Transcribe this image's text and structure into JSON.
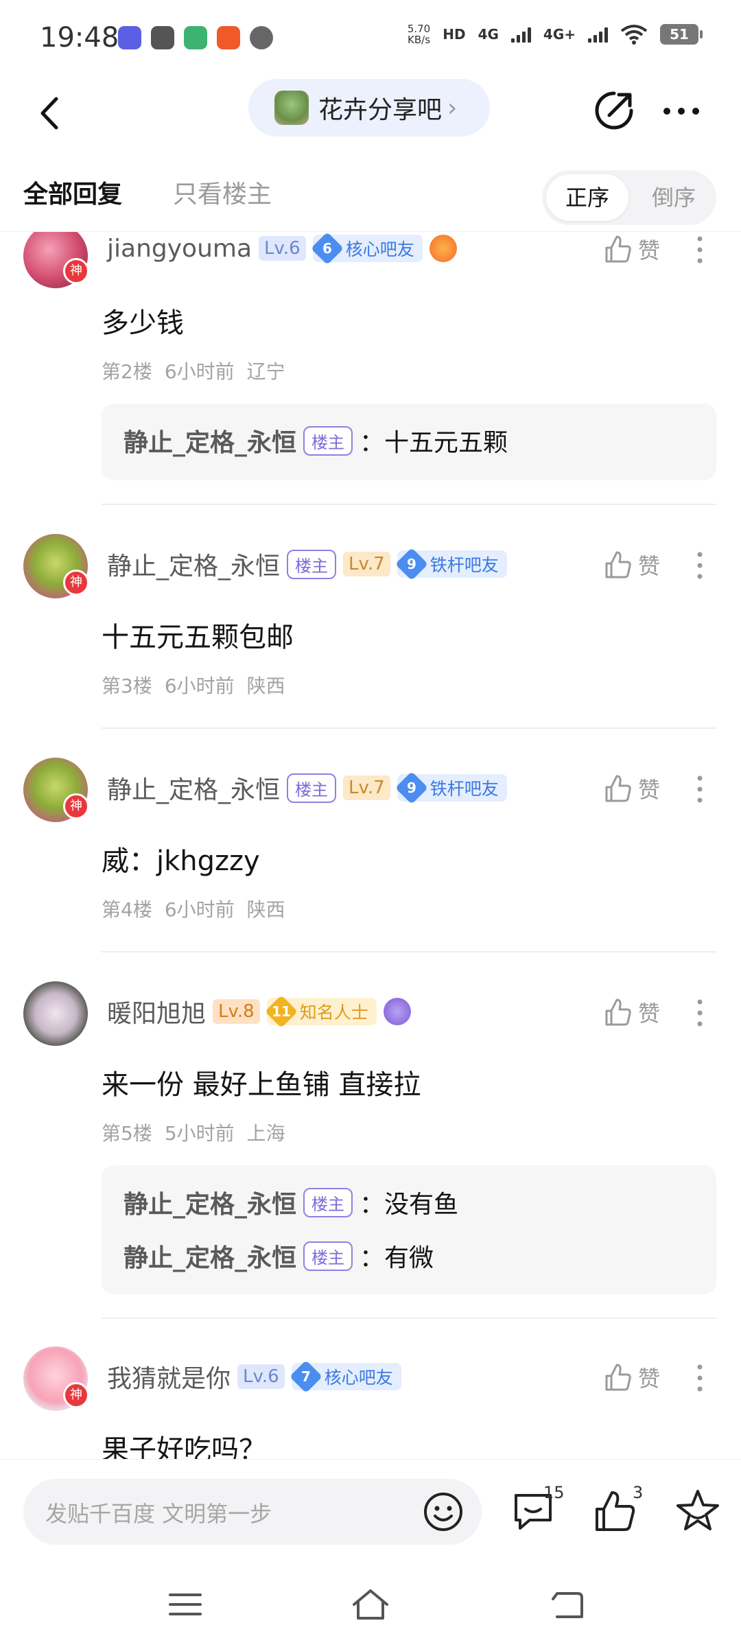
{
  "status_bar": {
    "time": "19:48",
    "net_speed_value": "5.70",
    "net_speed_unit": "KB/s",
    "hd_label": "HD",
    "network_1": "4G",
    "network_2": "4G+",
    "battery": "51"
  },
  "nav": {
    "forum_name": "花卉分享吧",
    "chevron": "›"
  },
  "tabs": {
    "all_replies": "全部回复",
    "op_only": "只看楼主",
    "order_asc": "正序",
    "order_desc": "倒序"
  },
  "like_label": "赞",
  "god_badge": "神",
  "op_badge": "楼主",
  "posts": [
    {
      "username": "jiangyouma",
      "level": "Lv.6",
      "fan_level": "6",
      "fan_title": "核心吧友",
      "content": "多少钱",
      "floor": "第2楼",
      "time": "6小时前",
      "location": "辽宁",
      "replies": [
        {
          "name": "静止_定格_永恒",
          "text": "：十五元五颗"
        }
      ]
    },
    {
      "username": "静止_定格_永恒",
      "level": "Lv.7",
      "fan_level": "9",
      "fan_title": "铁杆吧友",
      "content": "十五元五颗包邮",
      "floor": "第3楼",
      "time": "6小时前",
      "location": "陕西"
    },
    {
      "username": "静止_定格_永恒",
      "level": "Lv.7",
      "fan_level": "9",
      "fan_title": "铁杆吧友",
      "content": "威：jkhgzzy",
      "floor": "第4楼",
      "time": "6小时前",
      "location": "陕西"
    },
    {
      "username": "暖阳旭旭",
      "level": "Lv.8",
      "fan_level": "11",
      "fan_title": "知名人士",
      "content": "来一份 最好上鱼铺 直接拉",
      "floor": "第5楼",
      "time": "5小时前",
      "location": "上海",
      "replies": [
        {
          "name": "静止_定格_永恒",
          "text": "：没有鱼"
        },
        {
          "name": "静止_定格_永恒",
          "text": "：有微"
        }
      ]
    },
    {
      "username": "我猜就是你",
      "level": "Lv.6",
      "fan_level": "7",
      "fan_title": "核心吧友",
      "content": "果子好吃吗？"
    }
  ],
  "bottom_bar": {
    "input_placeholder": "发贴千百度 文明第一步",
    "comment_count": "15",
    "like_count": "3"
  },
  "colors": {
    "accent_blue": "#3c79e0",
    "op_badge_purple": "#7c6cd8",
    "god_badge_red": "#e8383d"
  }
}
